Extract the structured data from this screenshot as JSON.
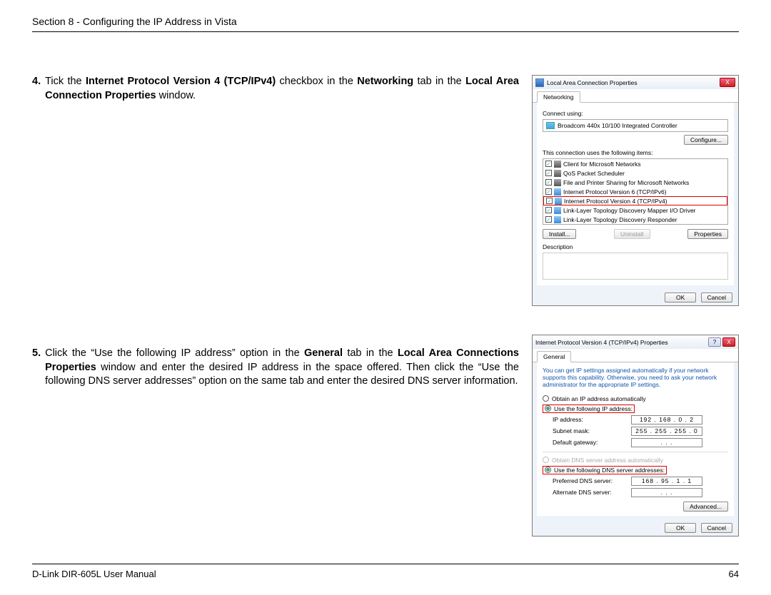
{
  "header": "Section 8 - Configuring the IP Address in Vista",
  "steps": {
    "s4": {
      "num": "4.",
      "pre": "Tick the ",
      "b1": "Internet Protocol Version 4 (TCP/IPv4)",
      "mid": " checkbox in the ",
      "b2": "Networking",
      "mid2": " tab in the ",
      "b3": "Local Area Connection Properties",
      "post": " window."
    },
    "s5": {
      "num": "5.",
      "pre": "Click the “Use the following IP address” option in the ",
      "b1": "General",
      "mid": " tab in the ",
      "b2": "Local Area Connections Properties",
      "post": " window and enter the desired IP address in the space offered. Then click the “Use the following DNS server addresses” option on the same tab and enter the desired DNS server information."
    }
  },
  "win1": {
    "title": "Local Area Connection Properties",
    "tab": "Networking",
    "connect_using": "Connect using:",
    "adapter": "Broadcom 440x 10/100 Integrated Controller",
    "configure": "Configure...",
    "uses_items": "This connection uses the following items:",
    "items": [
      "Client for Microsoft Networks",
      "QoS Packet Scheduler",
      "File and Printer Sharing for Microsoft Networks",
      "Internet Protocol Version 6 (TCP/IPv6)",
      "Internet Protocol Version 4 (TCP/IPv4)",
      "Link-Layer Topology Discovery Mapper I/O Driver",
      "Link-Layer Topology Discovery Responder"
    ],
    "install": "Install...",
    "uninstall": "Uninstall",
    "properties": "Properties",
    "description": "Description",
    "ok": "OK",
    "cancel": "Cancel"
  },
  "win2": {
    "title": "Internet Protocol Version 4 (TCP/IPv4) Properties",
    "tab": "General",
    "blurb": "You can get IP settings assigned automatically if your network supports this capability. Otherwise, you need to ask your network administrator for the appropriate IP settings.",
    "r_auto_ip": "Obtain an IP address automatically",
    "r_use_ip": "Use the following IP address:",
    "f_ip": "IP address:",
    "v_ip": "192 . 168 .  0  .  2",
    "f_mask": "Subnet mask:",
    "v_mask": "255 . 255 . 255 .  0",
    "f_gw": "Default gateway:",
    "v_gw": ".       .       .",
    "r_auto_dns": "Obtain DNS server address automatically",
    "r_use_dns": "Use the following DNS server addresses:",
    "f_pdns": "Preferred DNS server:",
    "v_pdns": "168 .  95 .  1  .  1",
    "f_adns": "Alternate DNS server:",
    "v_adns": ".       .       .",
    "advanced": "Advanced...",
    "ok": "OK",
    "cancel": "Cancel"
  },
  "footer": {
    "left": "D-Link DIR-605L User Manual",
    "right": "64"
  }
}
